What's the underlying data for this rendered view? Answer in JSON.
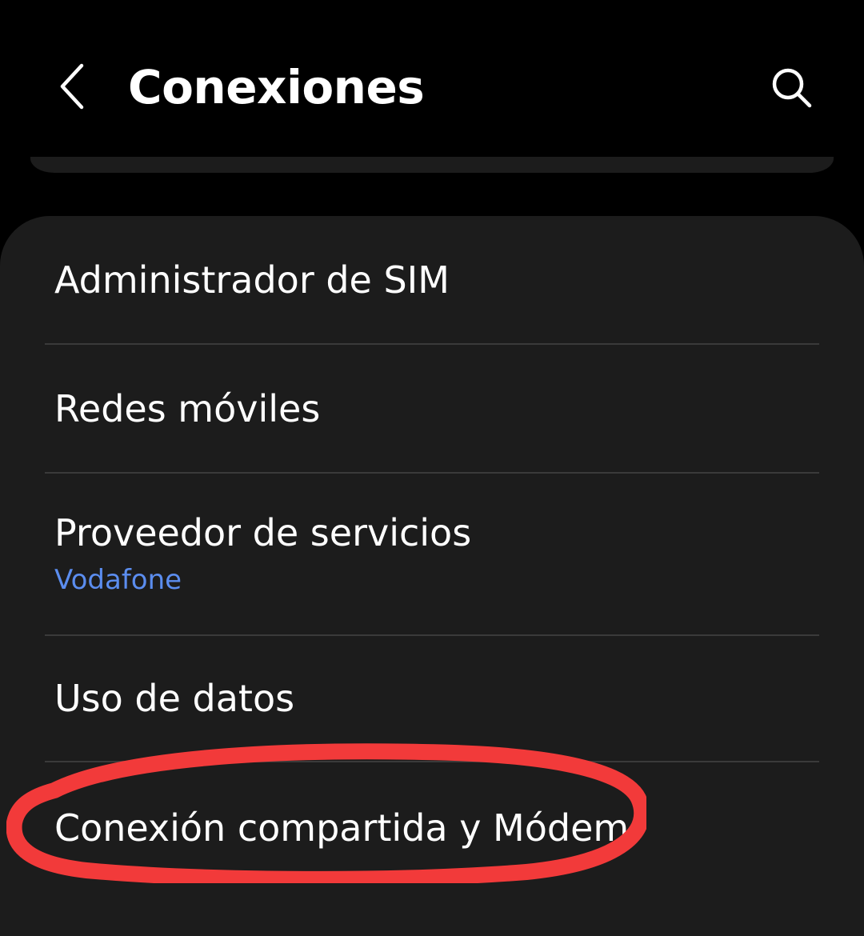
{
  "header": {
    "title": "Conexiones",
    "back_icon": "chevron-left-icon",
    "search_icon": "search-icon"
  },
  "settings": {
    "items": [
      {
        "label": "Administrador de SIM"
      },
      {
        "label": "Redes móviles"
      },
      {
        "label": "Proveedor de servicios",
        "sublabel": "Vodafone"
      },
      {
        "label": "Uso de datos"
      },
      {
        "label": "Conexión compartida y Módem"
      }
    ]
  },
  "colors": {
    "background": "#000000",
    "card": "#1c1c1c",
    "divider": "#3a3a3a",
    "sublabel_accent": "#5b8def",
    "annotation_red": "#f23a3a"
  }
}
